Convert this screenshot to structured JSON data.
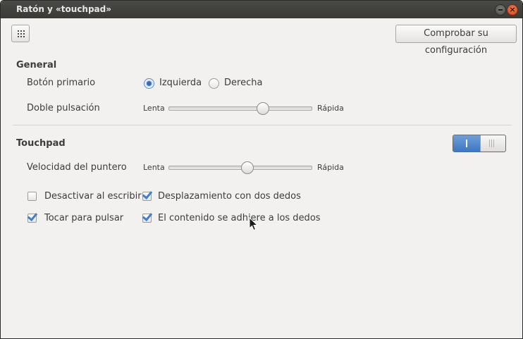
{
  "window": {
    "title": "Ratón y «touchpad»"
  },
  "toolbar": {
    "grid_icon": "grid-icon",
    "check_button_label": "Comprobar su configuración"
  },
  "general": {
    "heading": "General",
    "primary_button": {
      "label": "Botón primario",
      "options": [
        "Izquierda",
        "Derecha"
      ],
      "selected": "Izquierda"
    },
    "double_click": {
      "label": "Doble pulsación",
      "min_label": "Lenta",
      "max_label": "Rápida",
      "value_fraction": 0.66
    }
  },
  "touchpad": {
    "heading": "Touchpad",
    "switch_on": true,
    "pointer_speed": {
      "label": "Velocidad del puntero",
      "min_label": "Lenta",
      "max_label": "Rápida",
      "value_fraction": 0.55
    },
    "options": {
      "disable_while_typing": {
        "label": "Desactivar al escribir",
        "checked": false
      },
      "two_finger_scroll": {
        "label": "Desplazamiento con dos dedos",
        "checked": true
      },
      "tap_to_click": {
        "label": "Tocar para pulsar",
        "checked": true
      },
      "natural_scroll": {
        "label": "El contenido se adhiere a los dedos",
        "checked": true
      }
    }
  },
  "colors": {
    "accent": "#3c77c2",
    "titlebar": "#3c3b37",
    "background": "#f2f1f0"
  }
}
